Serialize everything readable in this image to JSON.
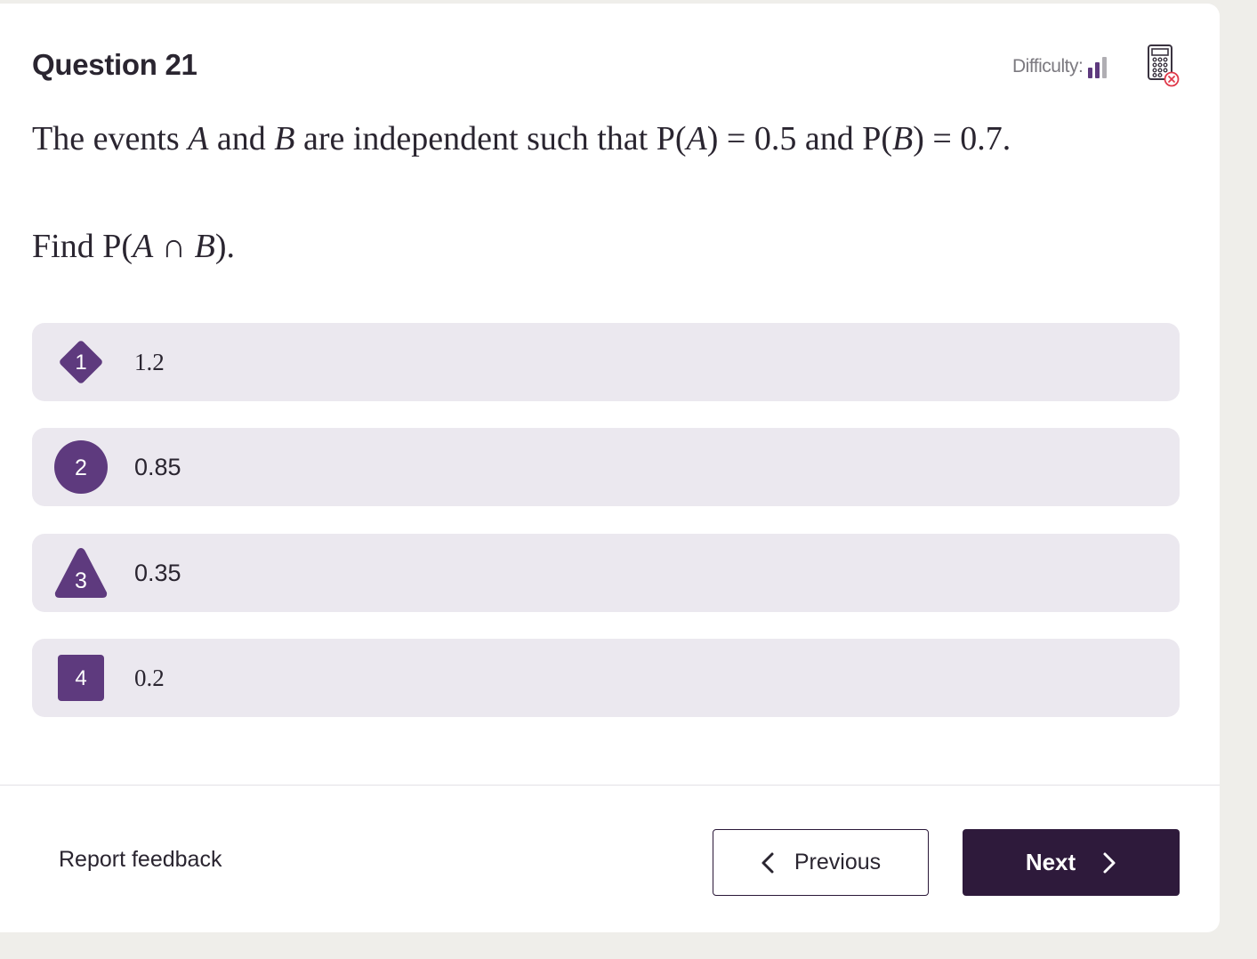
{
  "question": {
    "title": "Question 21",
    "difficulty_label": "Difficulty:",
    "difficulty_level": 2,
    "difficulty_max": 3,
    "text": {
      "s1": "The events ",
      "a": "A",
      "s2": " and ",
      "b": "B",
      "s3": " are independent such that ",
      "pa_open": "P(",
      "pa_var": "A",
      "pa_close": ") = 0.5",
      "s4": " and ",
      "pb_open": "P(",
      "pb_var": "B",
      "pb_close": ") = 0.7."
    },
    "find": {
      "prefix": "Find ",
      "p_open": "P(",
      "a": "A",
      "cap": " ∩ ",
      "b": "B",
      "p_close": ")."
    }
  },
  "options": [
    {
      "number": "1",
      "value": "1.2",
      "shape": "diamond"
    },
    {
      "number": "2",
      "value": "0.85",
      "shape": "circle"
    },
    {
      "number": "3",
      "value": "0.35",
      "shape": "triangle"
    },
    {
      "number": "4",
      "value": "0.2",
      "shape": "square"
    }
  ],
  "footer": {
    "report_label": "Report feedback",
    "previous_label": "Previous",
    "next_label": "Next"
  },
  "colors": {
    "accent": "#5e3a7e",
    "option_bg": "#ebe8ef",
    "next_bg": "#2e1a3b",
    "difficulty_active": "#5e3a7e",
    "difficulty_inactive": "#b0aeb3",
    "calc_x": "#e0394a"
  },
  "icons": {
    "calculator": "calculator-disabled-icon",
    "previous": "chevron-left-icon",
    "next": "chevron-right-icon"
  }
}
